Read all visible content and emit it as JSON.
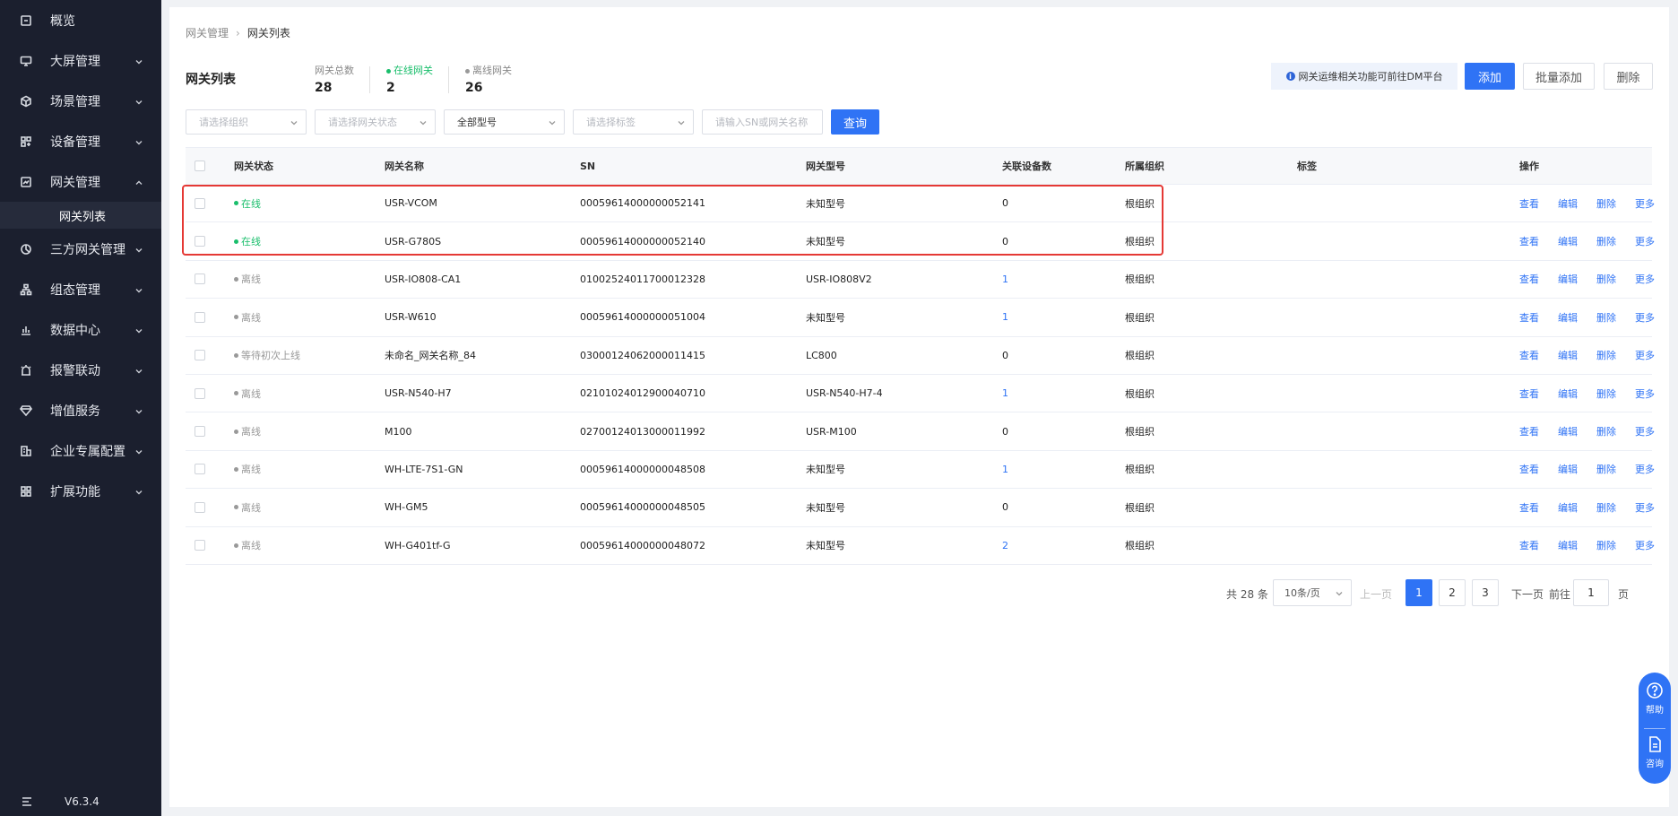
{
  "sidebar": {
    "items": [
      {
        "label": "概览",
        "icon": "overview-icon",
        "chevron": "",
        "expanded": false
      },
      {
        "label": "大屏管理",
        "icon": "screen-icon",
        "chevron": "down",
        "expanded": false
      },
      {
        "label": "场景管理",
        "icon": "cube-icon",
        "chevron": "down",
        "expanded": false
      },
      {
        "label": "设备管理",
        "icon": "device-icon",
        "chevron": "down",
        "expanded": false
      },
      {
        "label": "网关管理",
        "icon": "gateway-icon",
        "chevron": "up",
        "expanded": true
      },
      {
        "label": "三方网关管理",
        "icon": "third-party-icon",
        "chevron": "down",
        "expanded": false
      },
      {
        "label": "组态管理",
        "icon": "topology-icon",
        "chevron": "down",
        "expanded": false
      },
      {
        "label": "数据中心",
        "icon": "bar-chart-icon",
        "chevron": "down",
        "expanded": false
      },
      {
        "label": "报警联动",
        "icon": "alarm-icon",
        "chevron": "down",
        "expanded": false
      },
      {
        "label": "增值服务",
        "icon": "diamond-icon",
        "chevron": "down",
        "expanded": false
      },
      {
        "label": "企业专属配置",
        "icon": "building-icon",
        "chevron": "down",
        "expanded": false
      },
      {
        "label": "扩展功能",
        "icon": "apps-icon",
        "chevron": "down",
        "expanded": false
      }
    ],
    "sub_item": "网关列表",
    "version": "V6.3.4"
  },
  "breadcrumb": {
    "parent": "网关管理",
    "current": "网关列表"
  },
  "page_title": "网关列表",
  "stats": {
    "total_label": "网关总数",
    "total_value": "28",
    "online_label": "在线网关",
    "online_value": "2",
    "offline_label": "离线网关",
    "offline_value": "26"
  },
  "notice": "网关运维相关功能可前往DM平台",
  "actions": {
    "add": "添加",
    "batch_add": "批量添加",
    "delete": "删除"
  },
  "filters": {
    "org_placeholder": "请选择组织",
    "status_placeholder": "请选择网关状态",
    "model_value": "全部型号",
    "tag_placeholder": "请选择标签",
    "search_placeholder": "请输入SN或网关名称",
    "search_button": "查询"
  },
  "table": {
    "columns": [
      "网关状态",
      "网关名称",
      "SN",
      "网关型号",
      "关联设备数",
      "所属组织",
      "标签",
      "操作"
    ],
    "rows": [
      {
        "status": "在线",
        "online": true,
        "name": "USR-VCOM",
        "sn": "00059614000000052141",
        "model": "未知型号",
        "devices": "0",
        "org": "根组织"
      },
      {
        "status": "在线",
        "online": true,
        "name": "USR-G780S",
        "sn": "00059614000000052140",
        "model": "未知型号",
        "devices": "0",
        "org": "根组织"
      },
      {
        "status": "离线",
        "online": false,
        "name": "USR-IO808-CA1",
        "sn": "01002524011700012328",
        "model": "USR-IO808V2",
        "devices": "1",
        "org": "根组织"
      },
      {
        "status": "离线",
        "online": false,
        "name": "USR-W610",
        "sn": "00059614000000051004",
        "model": "未知型号",
        "devices": "1",
        "org": "根组织"
      },
      {
        "status": "等待初次上线",
        "online": false,
        "name": "未命名_网关名称_84",
        "sn": "03000124062000011415",
        "model": "LC800",
        "devices": "0",
        "org": "根组织"
      },
      {
        "status": "离线",
        "online": false,
        "name": "USR-N540-H7",
        "sn": "02101024012900040710",
        "model": "USR-N540-H7-4",
        "devices": "1",
        "org": "根组织"
      },
      {
        "status": "离线",
        "online": false,
        "name": "M100",
        "sn": "02700124013000011992",
        "model": "USR-M100",
        "devices": "0",
        "org": "根组织"
      },
      {
        "status": "离线",
        "online": false,
        "name": "WH-LTE-7S1-GN",
        "sn": "00059614000000048508",
        "model": "未知型号",
        "devices": "1",
        "org": "根组织"
      },
      {
        "status": "离线",
        "online": false,
        "name": "WH-GM5",
        "sn": "00059614000000048505",
        "model": "未知型号",
        "devices": "0",
        "org": "根组织"
      },
      {
        "status": "离线",
        "online": false,
        "name": "WH-G401tf-G",
        "sn": "00059614000000048072",
        "model": "未知型号",
        "devices": "2",
        "org": "根组织"
      }
    ],
    "ops": [
      "查看",
      "编辑",
      "删除",
      "更多"
    ]
  },
  "pagination": {
    "total": "共 28 条",
    "page_size": "10条/页",
    "prev": "上一页",
    "pages": [
      "1",
      "2",
      "3"
    ],
    "current": "1",
    "next": "下一页",
    "goto_label": "前往",
    "goto_value": "1",
    "page_suffix": "页"
  },
  "float_widget": {
    "help": "帮助",
    "consult": "咨询"
  },
  "colors": {
    "primary": "#2f73f5",
    "online": "#19be6b",
    "offline": "#999999",
    "sidebar": "#1b1f2e",
    "highlight": "#e53935"
  }
}
